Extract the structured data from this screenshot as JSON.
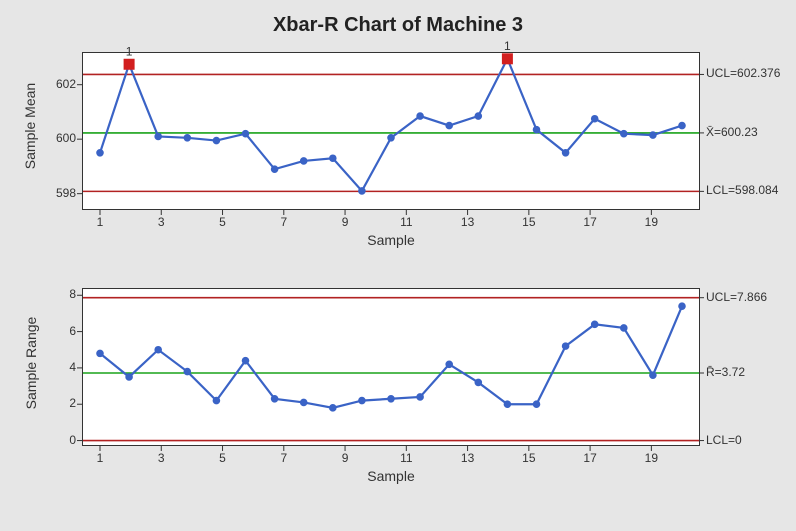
{
  "title": "Xbar-R Chart of Machine 3",
  "colors": {
    "frame_bg": "#e6e6e6",
    "panel_bg": "#ffffff",
    "line": "#3a63c6",
    "center": "#1aa31a",
    "limit": "#b22222",
    "ooc": "#d21f1f",
    "border": "#333333"
  },
  "axis_xlabel": "Sample",
  "axes_ylabels": {
    "top": "Sample Mean",
    "bottom": "Sample Range"
  },
  "chart_data": [
    {
      "type": "line",
      "name": "xbar",
      "title": "Sample Mean",
      "x": [
        1,
        2,
        3,
        4,
        5,
        6,
        7,
        8,
        9,
        10,
        11,
        12,
        13,
        14,
        15,
        16,
        17,
        18,
        19,
        20
      ],
      "values": [
        599.5,
        602.75,
        600.1,
        600.05,
        599.95,
        600.2,
        598.9,
        599.2,
        599.3,
        598.1,
        600.05,
        600.85,
        600.5,
        600.85,
        602.95,
        600.35,
        599.5,
        600.75,
        600.2,
        600.15,
        600.5
      ],
      "ooc_index": [
        1,
        14
      ],
      "ooc_label": "1",
      "center": 600.23,
      "ucl": 602.376,
      "lcl": 598.084,
      "center_label": "X̄=600.23",
      "ucl_label": "UCL=602.376",
      "lcl_label": "LCL=598.084",
      "yticks": [
        598,
        600,
        602
      ],
      "ylim": [
        597.4,
        603.2
      ],
      "xlabel": "Sample",
      "ylabel": "Sample Mean"
    },
    {
      "type": "line",
      "name": "range",
      "title": "Sample Range",
      "x": [
        1,
        2,
        3,
        4,
        5,
        6,
        7,
        8,
        9,
        10,
        11,
        12,
        13,
        14,
        15,
        16,
        17,
        18,
        19,
        20
      ],
      "values": [
        4.8,
        3.5,
        5.0,
        3.8,
        2.2,
        4.4,
        2.3,
        2.1,
        1.8,
        2.2,
        2.3,
        2.4,
        4.2,
        3.2,
        2.0,
        2.0,
        5.2,
        6.4,
        6.2,
        3.6,
        7.4
      ],
      "ooc_index": [],
      "ooc_label": "",
      "center": 3.72,
      "ucl": 7.866,
      "lcl": 0,
      "center_label": "R̄=3.72",
      "ucl_label": "UCL=7.866",
      "lcl_label": "LCL=0",
      "yticks": [
        0,
        2,
        4,
        6,
        8
      ],
      "ylim": [
        -0.3,
        8.4
      ],
      "xlabel": "Sample",
      "ylabel": "Sample Range"
    }
  ],
  "xticks": [
    1,
    3,
    5,
    7,
    9,
    11,
    13,
    15,
    17,
    19
  ]
}
